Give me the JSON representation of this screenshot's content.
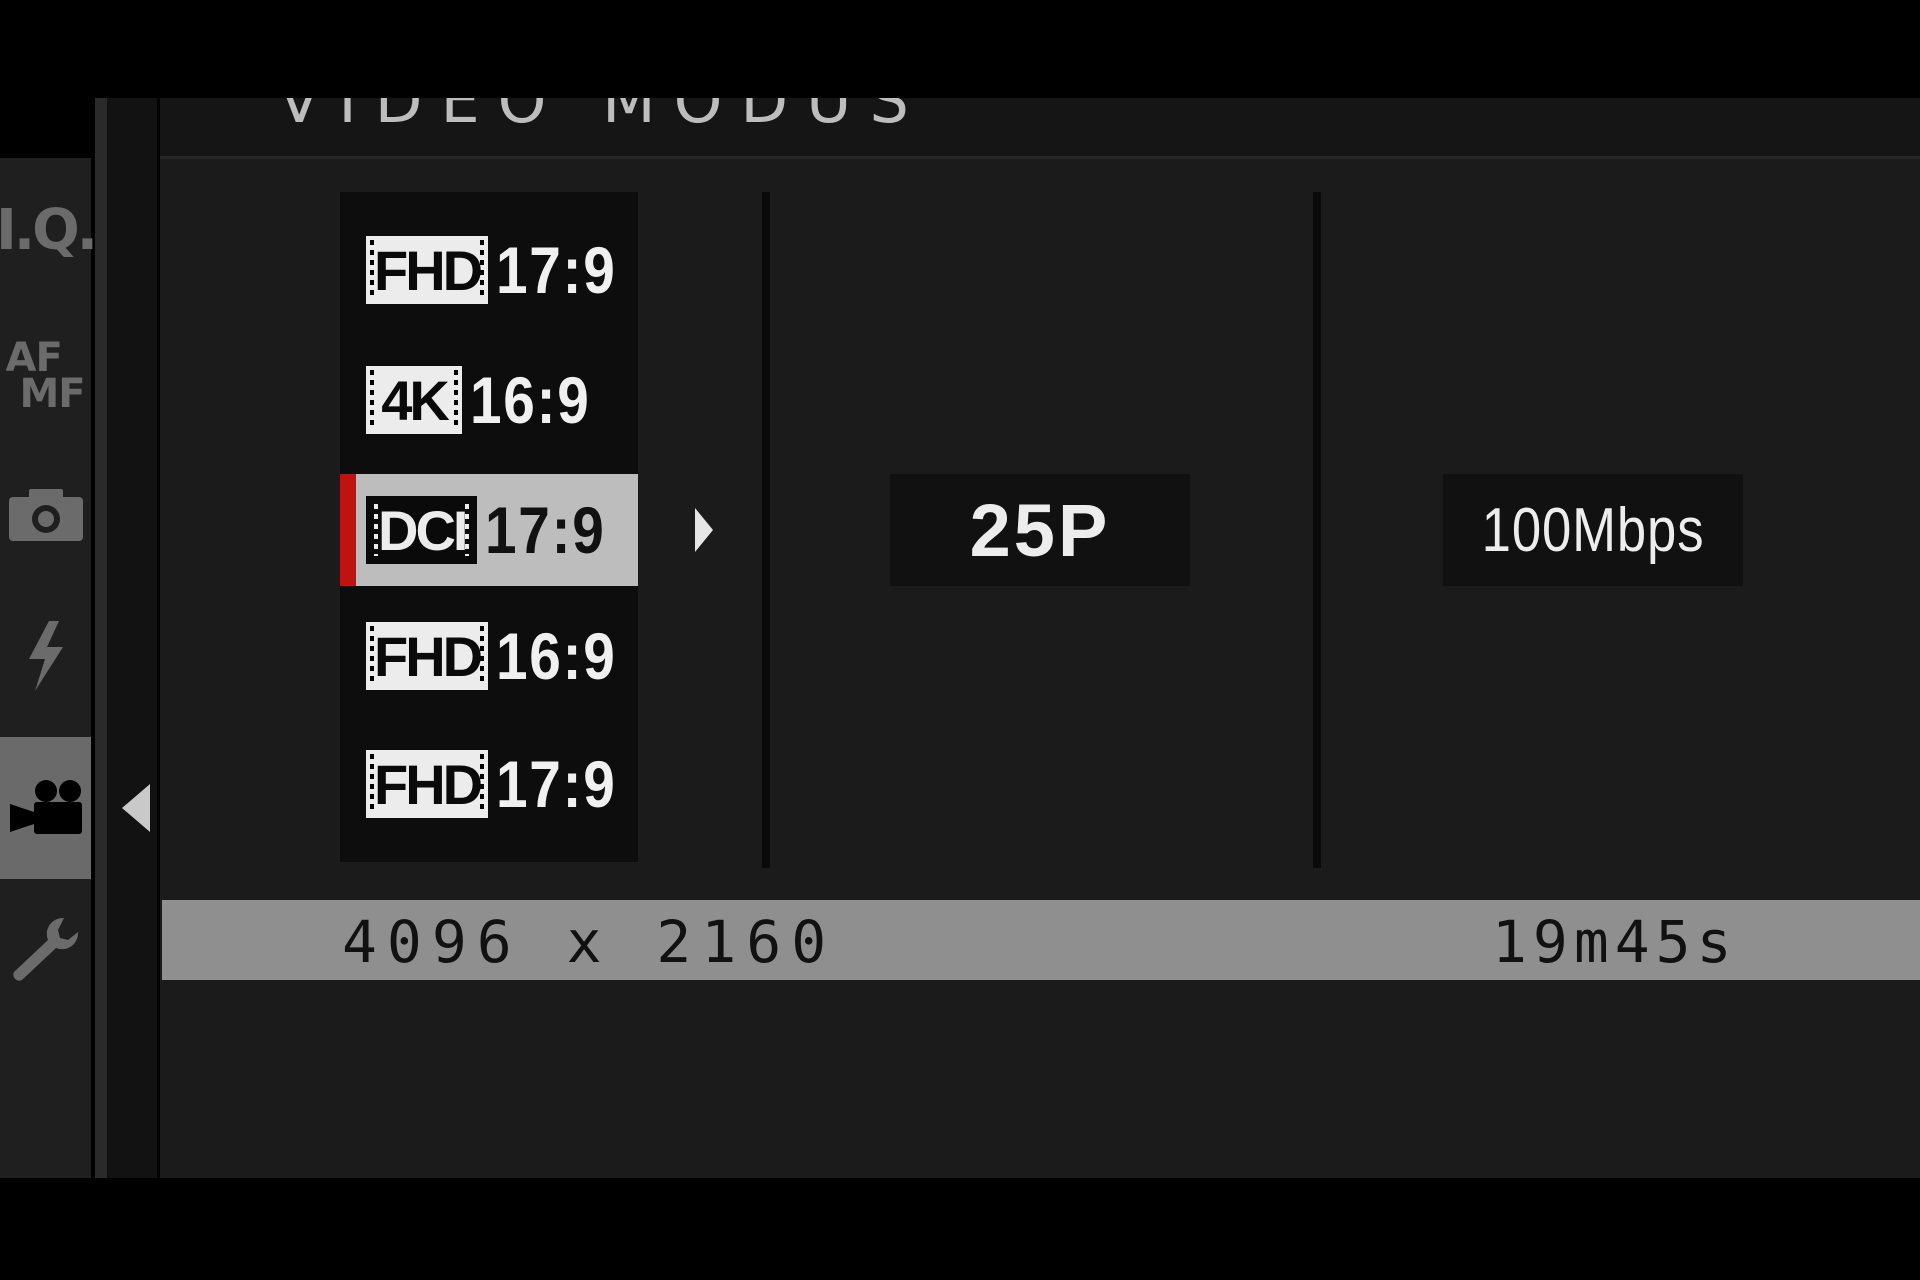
{
  "menu": {
    "title": "VIDEO MODUS"
  },
  "sidebar": {
    "items": [
      {
        "label": "I.Q.",
        "icon": "image-quality-icon",
        "active": false
      },
      {
        "label_top": "AF",
        "label_bottom": "MF",
        "icon": "af-mf-icon",
        "active": false
      },
      {
        "icon": "camera-icon",
        "active": false
      },
      {
        "icon": "flash-icon",
        "active": false
      },
      {
        "icon": "movie-camera-icon",
        "active": true
      },
      {
        "icon": "wrench-icon",
        "active": false
      }
    ]
  },
  "modes": [
    {
      "badge": "FHD",
      "ratio": "17:9",
      "selected": false
    },
    {
      "badge": "4K",
      "ratio": "16:9",
      "selected": false
    },
    {
      "badge": "DCI",
      "ratio": "17:9",
      "selected": true
    },
    {
      "badge": "FHD",
      "ratio": "16:9",
      "selected": false
    },
    {
      "badge": "FHD",
      "ratio": "17:9",
      "selected": false
    }
  ],
  "frame_rate": "25P",
  "bitrate": "100Mbps",
  "info": {
    "resolution": "4096 x 2160",
    "remaining_time": "19m45s"
  },
  "colors": {
    "selection_marker": "#c0130f",
    "selected_row": "#bdbdbd",
    "info_bar": "#8f8f8f"
  }
}
